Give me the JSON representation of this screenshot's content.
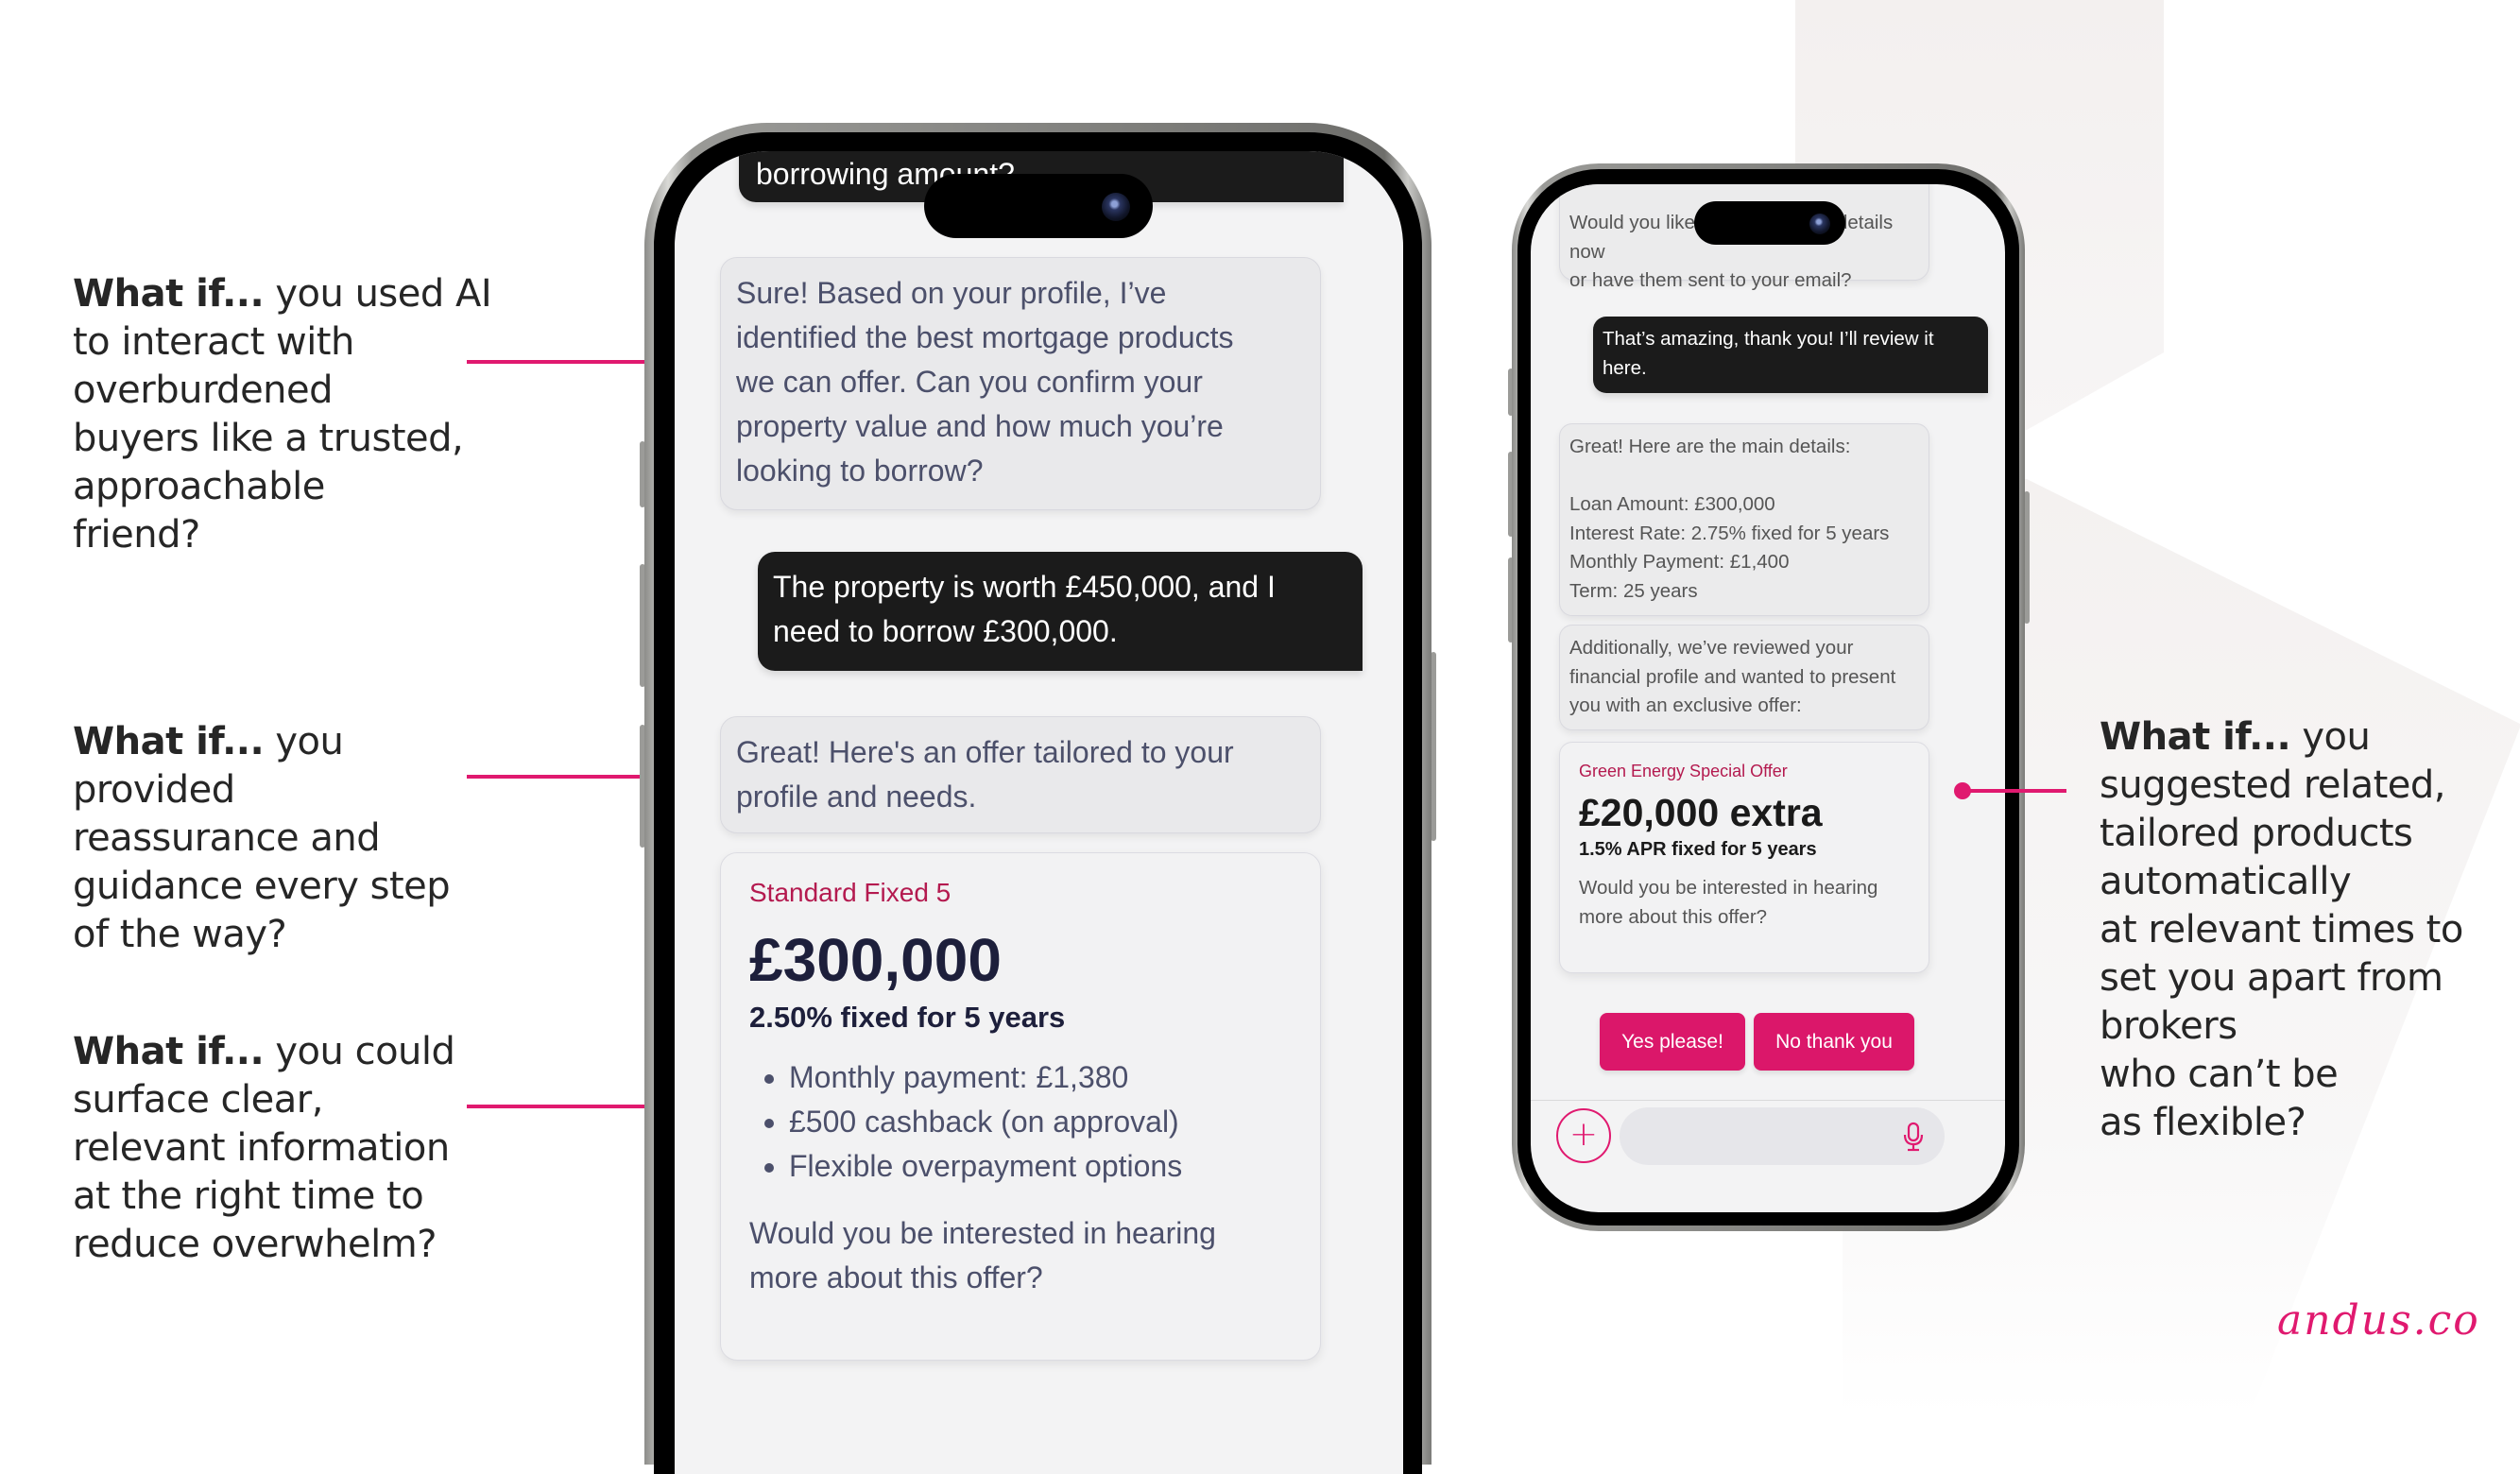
{
  "callouts": {
    "left": [
      {
        "lead": "What if...",
        "lines": [
          " you used AI",
          "to interact with",
          "overburdened",
          "buyers like a trusted,",
          "approachable",
          "friend?"
        ]
      },
      {
        "lead": "What if...",
        "lines": [
          " you",
          "provided",
          "reassurance and",
          "guidance every step",
          "of the way?"
        ]
      },
      {
        "lead": "What if...",
        "lines": [
          " you could",
          "surface clear,",
          "relevant information",
          "at the right time to",
          "reduce overwhelm?"
        ]
      }
    ],
    "right": {
      "lead": "What if...",
      "lines": [
        " you",
        "suggested related,",
        "tailored products",
        "automatically",
        "at relevant times to",
        "set you apart from",
        "brokers",
        "who can’t be",
        "as flexible?"
      ]
    }
  },
  "phone_left": {
    "user_message_partial": "borrowing amount?",
    "ai_message_1": [
      "Sure! Based on your profile, I’ve",
      "identified the best mortgage products",
      "we can offer. Can you confirm your",
      "property value and how much you’re",
      "looking to borrow?"
    ],
    "user_message_2": [
      "The property is worth £450,000, and I",
      "need to borrow £300,000."
    ],
    "ai_message_2": [
      "Great! Here's an offer tailored to your",
      "profile and needs."
    ],
    "offer_card": {
      "label": "Standard Fixed 5",
      "amount": "£300,000",
      "rate": "2.50% fixed for 5 years",
      "bullets": [
        "Monthly payment: £1,380",
        "£500 cashback (on approval)",
        "Flexible overpayment options"
      ],
      "question": [
        "Would you be interested in hearing",
        "more about this offer?"
      ]
    }
  },
  "phone_right": {
    "ai_message_partial": [
      "Would you like to see the details now",
      "or have them sent to your email?"
    ],
    "ai_partial_visible_left": "Would you like",
    "ai_partial_visible_right": "details now",
    "user_message": [
      "That’s amazing, thank you! I’ll review it",
      "here."
    ],
    "ai_details": {
      "intro": "Great! Here are the main details:",
      "items": [
        "Loan Amount: £300,000",
        "Interest Rate: 2.75% fixed for 5 years",
        "Monthly Payment: £1,400",
        "Term: 25 years"
      ]
    },
    "ai_message_2": [
      "Additionally, we’ve reviewed your",
      "financial profile and wanted to present",
      "you with an exclusive offer:"
    ],
    "offer_card": {
      "label": "Green Energy Special Offer",
      "amount": "£20,000 extra",
      "rate": "1.5% APR fixed for 5 years",
      "question": [
        "Would you be interested in hearing",
        "more about this offer?"
      ]
    },
    "buttons": {
      "yes": "Yes please!",
      "no": "No thank you"
    },
    "composer": {
      "add_icon": "plus-icon",
      "mic_icon": "microphone-icon",
      "input_value": ""
    }
  },
  "brand": {
    "logo": "andus.co",
    "accent_color": "#e0196f"
  }
}
